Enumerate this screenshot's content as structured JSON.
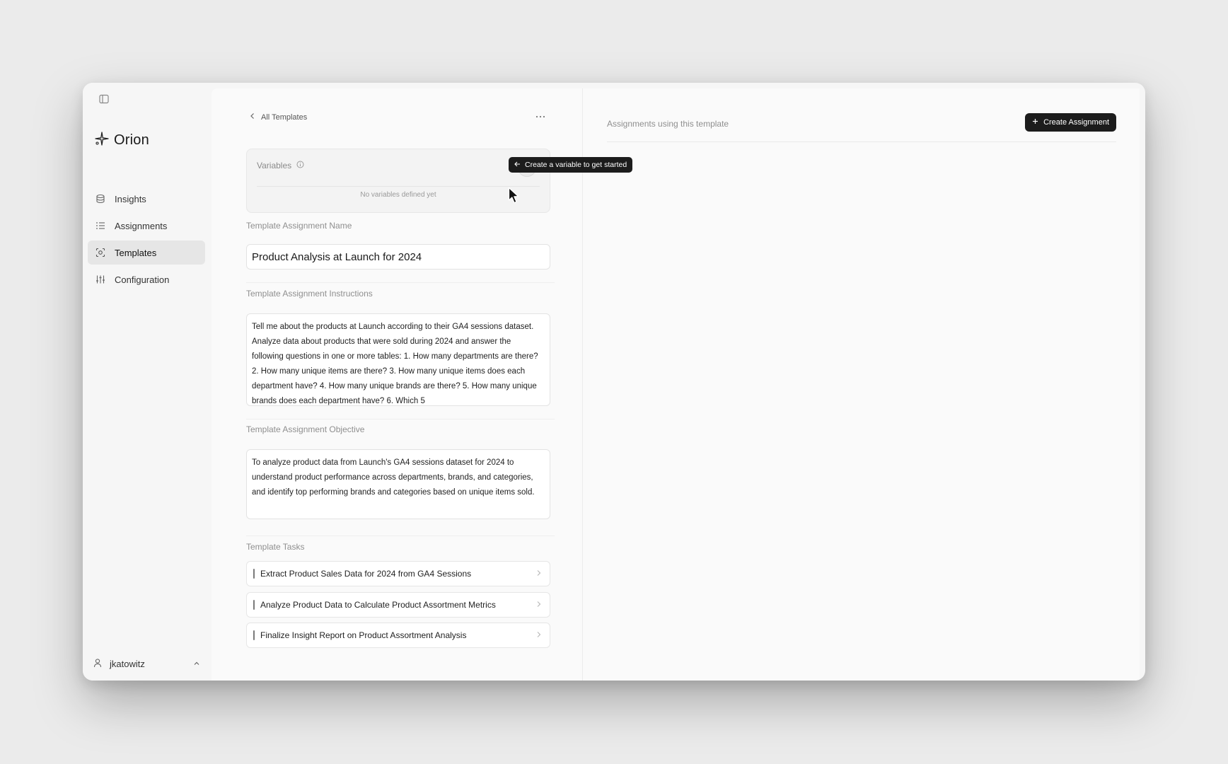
{
  "app": {
    "name": "Orion",
    "logo_icon": "sparkle-icon",
    "sidebar_toggle_icon": "sidebar-toggle-icon"
  },
  "sidebar": {
    "items": [
      {
        "label": "Insights",
        "icon": "database-icon",
        "active": false
      },
      {
        "label": "Assignments",
        "icon": "list-icon",
        "active": false
      },
      {
        "label": "Templates",
        "icon": "template-icon",
        "active": true
      },
      {
        "label": "Configuration",
        "icon": "sliders-icon",
        "active": false
      }
    ],
    "user": {
      "name": "jkatowitz",
      "icon": "user-icon",
      "chevron": "chevron-up-icon"
    }
  },
  "template": {
    "back_label": "All Templates",
    "more_icon": "more-horizontal-icon",
    "variables": {
      "title": "Variables",
      "empty_text": "No variables defined yet",
      "add_icon": "plus-icon",
      "info_icon": "info-icon"
    },
    "tooltip": "Create a variable to get started",
    "name": {
      "label": "Template Assignment Name",
      "value": "Product Analysis at Launch for 2024"
    },
    "instructions": {
      "label": "Template Assignment Instructions",
      "value": "Tell me about the products at Launch according to their GA4 sessions dataset. Analyze data about products that were sold during 2024 and answer the following questions in one or more tables: 1. How many departments are there? 2. How many unique items are there? 3. How many unique items does each department have? 4. How many unique brands are there? 5. How many unique brands does each department have? 6. Which 5"
    },
    "objective": {
      "label": "Template Assignment Objective",
      "value": "To analyze product data from Launch's GA4 sessions dataset for 2024 to understand product performance across departments, brands, and categories, and identify top performing brands and categories based on unique items sold."
    },
    "tasks": {
      "label": "Template Tasks",
      "items": [
        "Extract Product Sales Data for 2024 from GA4 Sessions",
        "Analyze Product Data to Calculate Product Assortment Metrics",
        "Finalize Insight Report on Product Assortment Analysis"
      ]
    }
  },
  "assignments_panel": {
    "title": "Assignments using this template",
    "create_button": "Create Assignment"
  }
}
